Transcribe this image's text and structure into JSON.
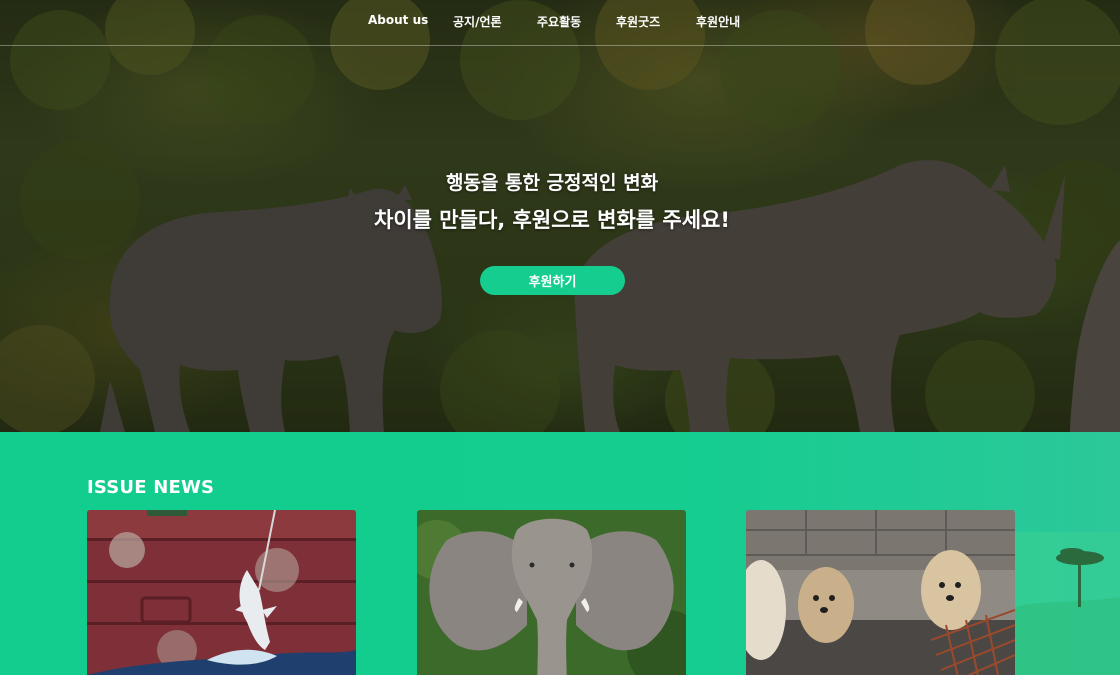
{
  "nav": {
    "items": [
      {
        "label": "About us"
      },
      {
        "label": "공지/언론"
      },
      {
        "label": "주요활동"
      },
      {
        "label": "후원굿즈"
      },
      {
        "label": "후원안내"
      }
    ]
  },
  "hero": {
    "line1": "행동을 통한 긍정적인 변화",
    "line2": "차이를 만들다, 후원으로 변화를 주세요!",
    "button_label": "후원하기",
    "image": "rhinos-photo"
  },
  "issue_news": {
    "title": "ISSUE NEWS",
    "cards": [
      {
        "image": "shark-hook-photo"
      },
      {
        "image": "elephant-photo"
      },
      {
        "image": "caged-dogs-photo"
      }
    ]
  },
  "colors": {
    "accent": "#14cd8f",
    "text_light": "#ffffff"
  }
}
